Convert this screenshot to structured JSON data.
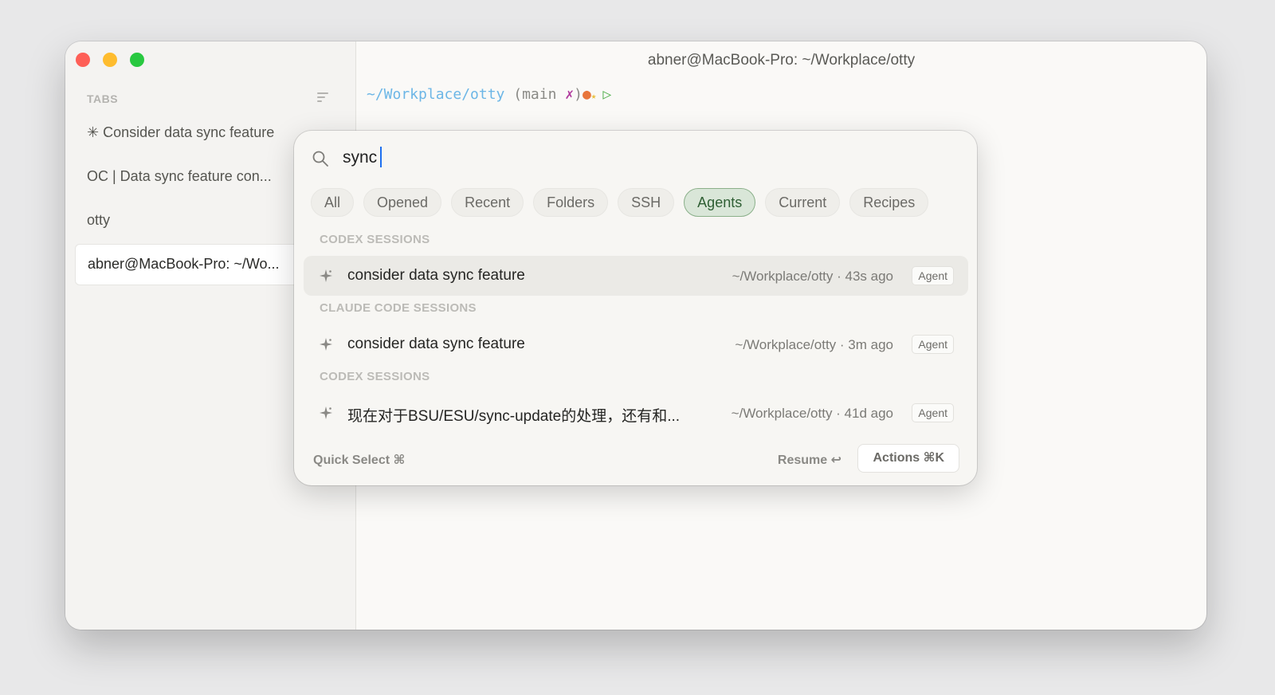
{
  "window": {
    "title": "abner@MacBook-Pro: ~/Workplace/otty"
  },
  "sidebar": {
    "header": "TABS",
    "items": [
      {
        "label": "✳ Consider data sync feature"
      },
      {
        "label": "OC | Data sync feature con..."
      },
      {
        "label": "otty"
      },
      {
        "label": "abner@MacBook-Pro: ~/Wo..."
      }
    ]
  },
  "terminal": {
    "path": "~/Workplace/otty",
    "branch_open": " (main ",
    "branch_mark": "✗",
    "branch_close": ")",
    "dot": "●",
    "star": "★",
    "arrow": "▷"
  },
  "palette": {
    "search_value": "sync",
    "filters": [
      {
        "label": "All",
        "active": false
      },
      {
        "label": "Opened",
        "active": false
      },
      {
        "label": "Recent",
        "active": false
      },
      {
        "label": "Folders",
        "active": false
      },
      {
        "label": "SSH",
        "active": false
      },
      {
        "label": "Agents",
        "active": true
      },
      {
        "label": "Current",
        "active": false
      },
      {
        "label": "Recipes",
        "active": false
      }
    ],
    "sections": [
      {
        "label": "CODEX SESSIONS",
        "rows": [
          {
            "title": "consider data sync feature",
            "meta": "~/Workplace/otty · 43s ago",
            "badge": "Agent",
            "selected": true
          }
        ]
      },
      {
        "label": "CLAUDE CODE SESSIONS",
        "rows": [
          {
            "title": "consider data sync feature",
            "meta": "~/Workplace/otty · 3m ago",
            "badge": "Agent",
            "selected": false
          }
        ]
      },
      {
        "label": "CODEX SESSIONS",
        "rows": [
          {
            "title": "现在对于BSU/ESU/sync-update的处理，还有和...",
            "meta": "~/Workplace/otty · 41d ago",
            "badge": "Agent",
            "selected": false
          }
        ]
      }
    ],
    "footer": {
      "quick_select": "Quick Select ⌘",
      "resume": "Resume ↩",
      "actions": "Actions ⌘K"
    }
  },
  "colors": {
    "accent": "#8bb08a",
    "caret": "#1e6ff0"
  }
}
